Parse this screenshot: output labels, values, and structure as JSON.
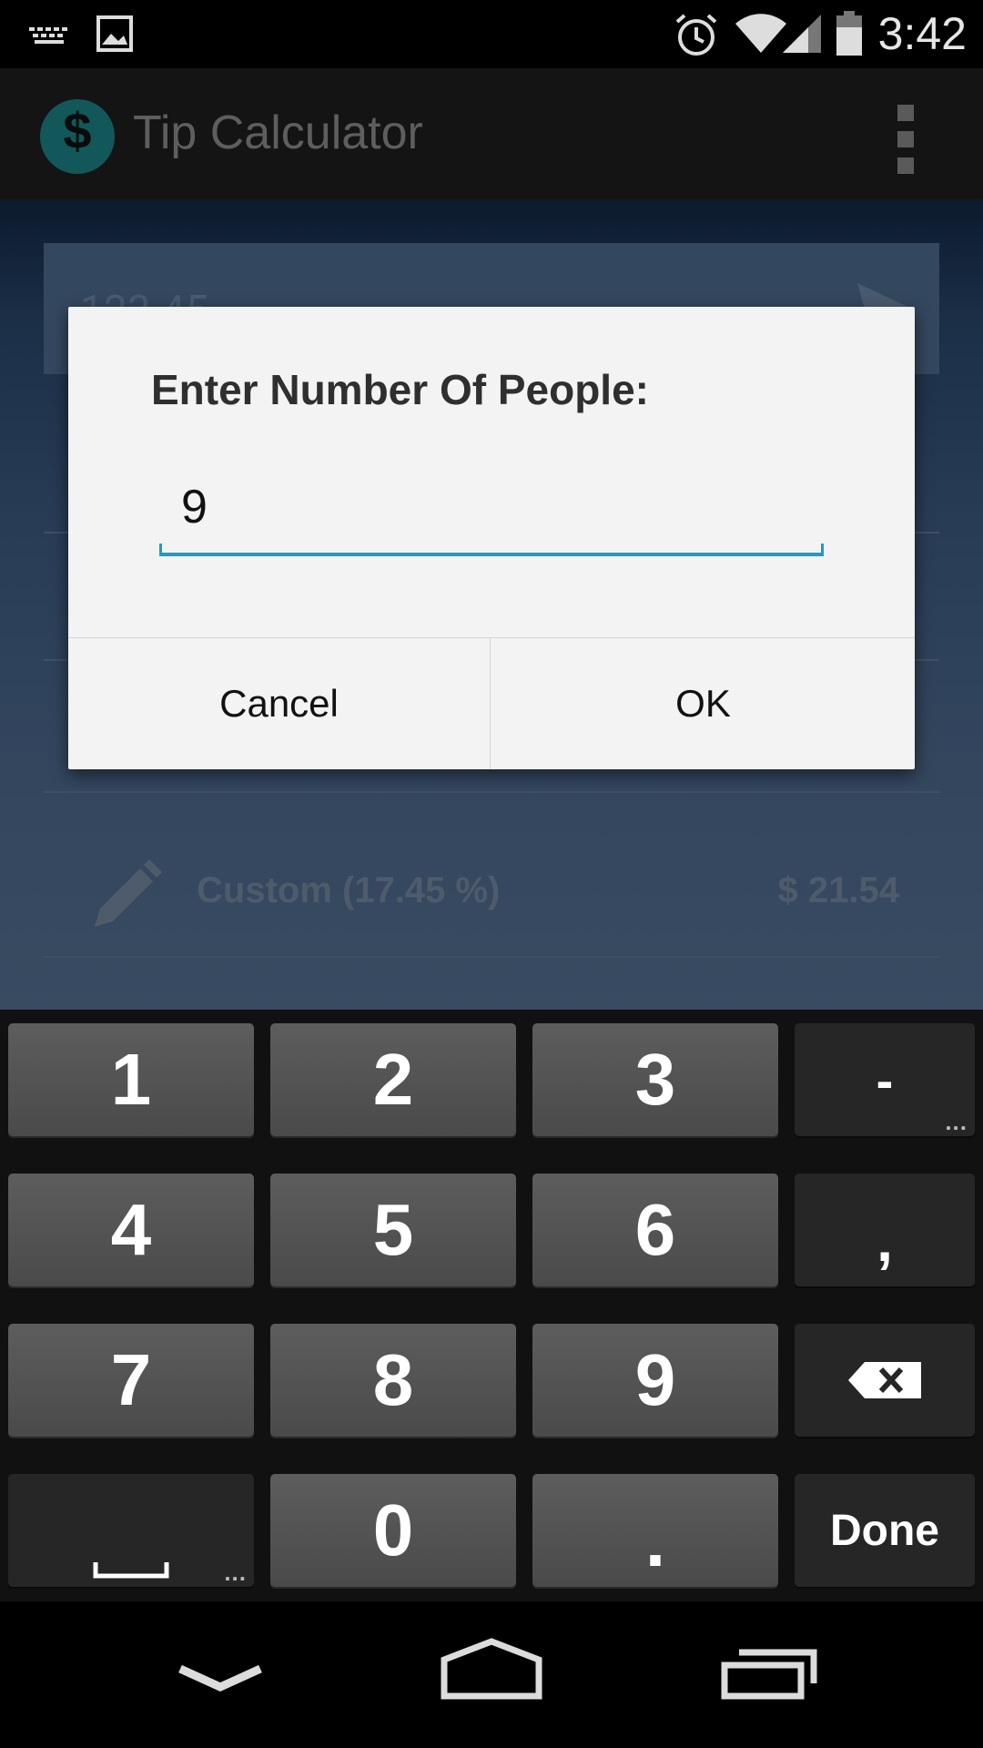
{
  "status_bar": {
    "time": "3:42",
    "icons": [
      "keyboard-icon",
      "image-icon",
      "alarm-icon",
      "wifi-icon",
      "signal-icon",
      "battery-icon"
    ]
  },
  "action_bar": {
    "logo_symbol": "$",
    "title": "Tip Calculator",
    "overflow_icon": "overflow-menu-icon"
  },
  "background": {
    "bill_amount": "123.45",
    "custom_label": "Custom (17.45 %)",
    "custom_amount": "$ 21.54"
  },
  "dialog": {
    "title": "Enter Number Of People:",
    "input_value": "9",
    "cancel_label": "Cancel",
    "ok_label": "OK",
    "accent_color": "#1f9bc9"
  },
  "keyboard": {
    "row1": [
      "1",
      "2",
      "3"
    ],
    "row2": [
      "4",
      "5",
      "6"
    ],
    "row3": [
      "7",
      "8",
      "9"
    ],
    "row4": [
      "0",
      "."
    ],
    "fn_row1": "-",
    "fn_row2": ",",
    "fn_row3": "backspace",
    "fn_row4": "Done",
    "space": "space"
  },
  "nav_bar": {
    "buttons": [
      "back-icon",
      "home-icon",
      "recents-icon"
    ]
  }
}
